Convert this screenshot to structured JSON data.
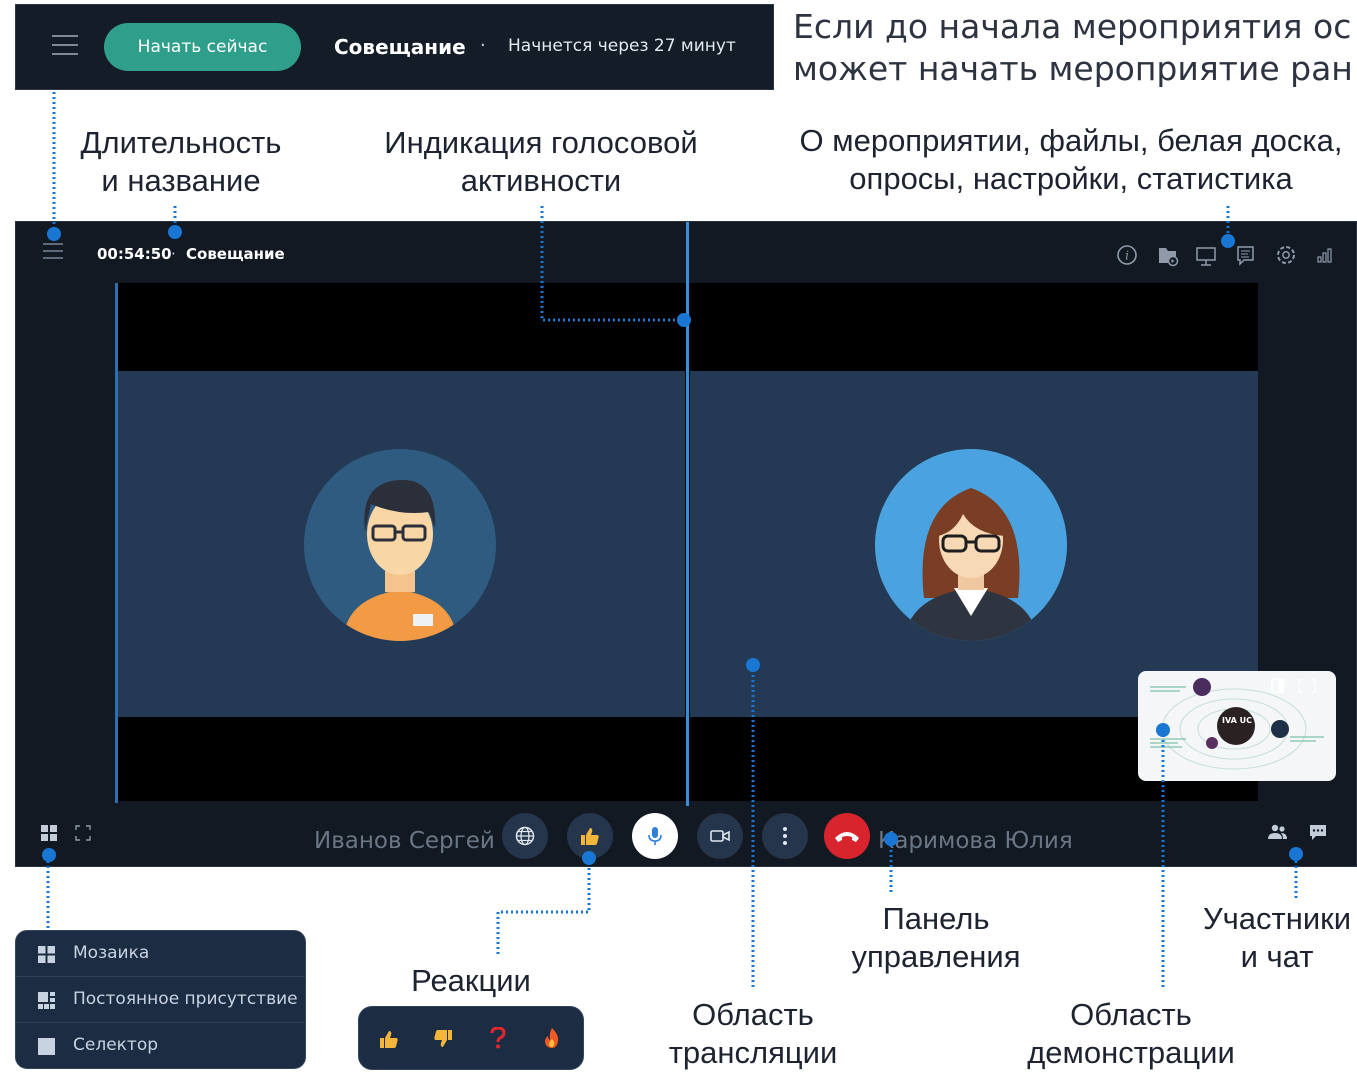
{
  "topbar": {
    "start_button": "Начать сейчас",
    "meeting_title": "Совещание",
    "separator": "·",
    "status": "Начнется через 27 минут"
  },
  "intro_text": {
    "line1": "Если до начала мероприятия ос",
    "line2": "может начать мероприятие ран"
  },
  "captions": {
    "duration_title": [
      "Длительность",
      "и название"
    ],
    "voice_activity": [
      "Индикация голосовой",
      "активности"
    ],
    "about_tools": [
      "О мероприятии, файлы, белая доска,",
      "опросы, настройки, статистика"
    ],
    "reactions": "Реакции",
    "broadcast_area": [
      "Область",
      "трансляции"
    ],
    "control_panel": [
      "Панель",
      "управления"
    ],
    "demo_area": [
      "Область",
      "демонстрации"
    ],
    "participants_chat": [
      "Участники",
      "и чат"
    ]
  },
  "stage": {
    "timer": "00:54:50",
    "separator": "·",
    "title": "Совещание",
    "participants": [
      {
        "name": "Иванов Сергей"
      },
      {
        "name": "Каримова Юлия"
      }
    ],
    "top_icons": [
      "info-icon",
      "files-icon",
      "whiteboard-icon",
      "polls-icon",
      "settings-icon",
      "statistics-icon"
    ],
    "controls": [
      "globe-icon",
      "thumbs-up-icon",
      "microphone-icon",
      "camera-icon",
      "more-icon",
      "hang-up-icon"
    ],
    "demo_preview_label": "IVA UC"
  },
  "layout_menu": {
    "items": [
      {
        "label": "Мозаика",
        "icon": "mosaic-icon"
      },
      {
        "label": "Постоянное присутствие",
        "icon": "permanent-presence-icon"
      },
      {
        "label": "Селектор",
        "icon": "selector-icon"
      }
    ]
  },
  "reactions_menu": {
    "items": [
      "thumbs-up-icon",
      "thumbs-down-icon",
      "question-icon",
      "fire-icon"
    ]
  },
  "colors": {
    "accent_blue": "#1976d2",
    "start_green": "#2f9f8b",
    "hangup_red": "#d8242c",
    "panel_dark": "#121923"
  }
}
